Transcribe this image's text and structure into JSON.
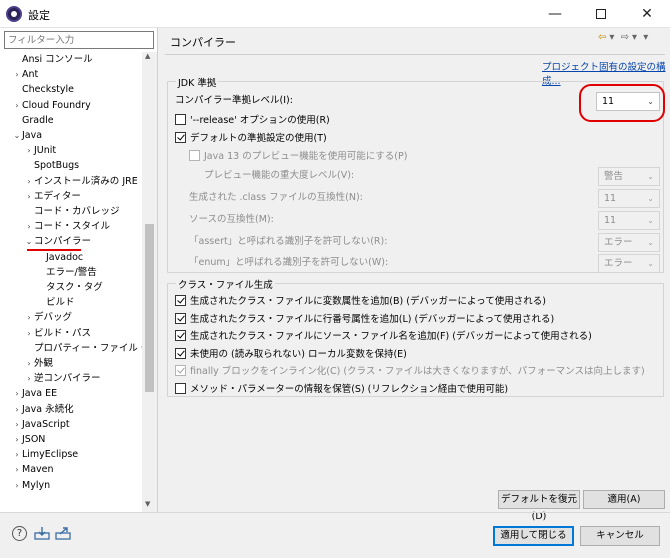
{
  "window": {
    "title": "設定",
    "min": "—",
    "close": "✕"
  },
  "left": {
    "filter_placeholder": "フィルター入力",
    "tree": [
      {
        "label": "Ansi コンソール",
        "indent": 0,
        "tw": ""
      },
      {
        "label": "Ant",
        "indent": 0,
        "tw": "›"
      },
      {
        "label": "Checkstyle",
        "indent": 0,
        "tw": ""
      },
      {
        "label": "Cloud Foundry",
        "indent": 0,
        "tw": "›"
      },
      {
        "label": "Gradle",
        "indent": 0,
        "tw": ""
      },
      {
        "label": "Java",
        "indent": 0,
        "tw": "⌄"
      },
      {
        "label": "JUnit",
        "indent": 1,
        "tw": "›"
      },
      {
        "label": "SpotBugs",
        "indent": 1,
        "tw": ""
      },
      {
        "label": "インストール済みの JRE",
        "indent": 1,
        "tw": "›"
      },
      {
        "label": "エディター",
        "indent": 1,
        "tw": "›"
      },
      {
        "label": "コード・カバレッジ",
        "indent": 1,
        "tw": ""
      },
      {
        "label": "コード・スタイル",
        "indent": 1,
        "tw": "›"
      },
      {
        "label": "コンパイラー",
        "indent": 1,
        "tw": "⌄"
      },
      {
        "label": "Javadoc",
        "indent": 2,
        "tw": ""
      },
      {
        "label": "エラー/警告",
        "indent": 2,
        "tw": ""
      },
      {
        "label": "タスク・タグ",
        "indent": 2,
        "tw": ""
      },
      {
        "label": "ビルド",
        "indent": 2,
        "tw": ""
      },
      {
        "label": "デバッグ",
        "indent": 1,
        "tw": "›"
      },
      {
        "label": "ビルド・パス",
        "indent": 1,
        "tw": "›"
      },
      {
        "label": "プロパティー・ファイル・エディタ",
        "indent": 1,
        "tw": ""
      },
      {
        "label": "外観",
        "indent": 1,
        "tw": "›"
      },
      {
        "label": "逆コンパイラー",
        "indent": 1,
        "tw": "›"
      },
      {
        "label": "Java EE",
        "indent": 0,
        "tw": "›"
      },
      {
        "label": "Java 永続化",
        "indent": 0,
        "tw": "›"
      },
      {
        "label": "JavaScript",
        "indent": 0,
        "tw": "›"
      },
      {
        "label": "JSON",
        "indent": 0,
        "tw": "›"
      },
      {
        "label": "LimyEclipse",
        "indent": 0,
        "tw": "›"
      },
      {
        "label": "Maven",
        "indent": 0,
        "tw": "›"
      },
      {
        "label": "Mylyn",
        "indent": 0,
        "tw": "›"
      }
    ]
  },
  "main": {
    "page_title": "コンパイラー",
    "project_link": "プロジェクト固有の設定の構成...",
    "jdk": {
      "group_label": "JDK 準拠",
      "level_label": "コンパイラー準拠レベル(I):",
      "level_value": "11",
      "release_label": "'--release' オプションの使用(R)",
      "release_checked": false,
      "default_label": "デフォルトの準拠設定の使用(T)",
      "default_checked": true,
      "preview_label": "Java 13 のプレビュー機能を使用可能にする(P)",
      "preview_severity_label": "プレビュー機能の重大度レベル(V):",
      "preview_severity_value": "警告",
      "classfile_label": "生成された .class ファイルの互換性(N):",
      "classfile_value": "11",
      "source_label": "ソースの互換性(M):",
      "source_value": "11",
      "assert_label": "「assert」と呼ばれる識別子を許可しない(R):",
      "assert_value": "エラー",
      "enum_label": "「enum」と呼ばれる識別子を許可しない(W):",
      "enum_value": "エラー"
    },
    "classfile": {
      "group_label": "クラス・ファイル生成",
      "items": [
        {
          "label": "生成されたクラス・ファイルに変数属性を追加(B) (デバッガーによって使用される)",
          "checked": true,
          "disabled": false
        },
        {
          "label": "生成されたクラス・ファイルに行番号属性を追加(L) (デバッガーによって使用される)",
          "checked": true,
          "disabled": false
        },
        {
          "label": "生成されたクラス・ファイルにソース・ファイル名を追加(F) (デバッガーによって使用される)",
          "checked": true,
          "disabled": false
        },
        {
          "label": "未使用の (読み取られない) ローカル変数を保持(E)",
          "checked": true,
          "disabled": false
        },
        {
          "label": "finally ブロックをインライン化(C) (クラス・ファイルは大きくなりますが、パフォーマンスは向上します)",
          "checked": true,
          "disabled": true
        },
        {
          "label": "メソッド・パラメーターの情報を保管(S) (リフレクション経由で使用可能)",
          "checked": false,
          "disabled": false
        }
      ]
    },
    "restore_defaults": "デフォルトを復元(D)",
    "apply": "適用(A)"
  },
  "footer": {
    "help": "?",
    "apply_close": "適用して閉じる",
    "cancel": "キャンセル"
  },
  "colors": {
    "accent": "#0078d7",
    "annotation_red": "#e00000",
    "link": "#0645ad"
  }
}
